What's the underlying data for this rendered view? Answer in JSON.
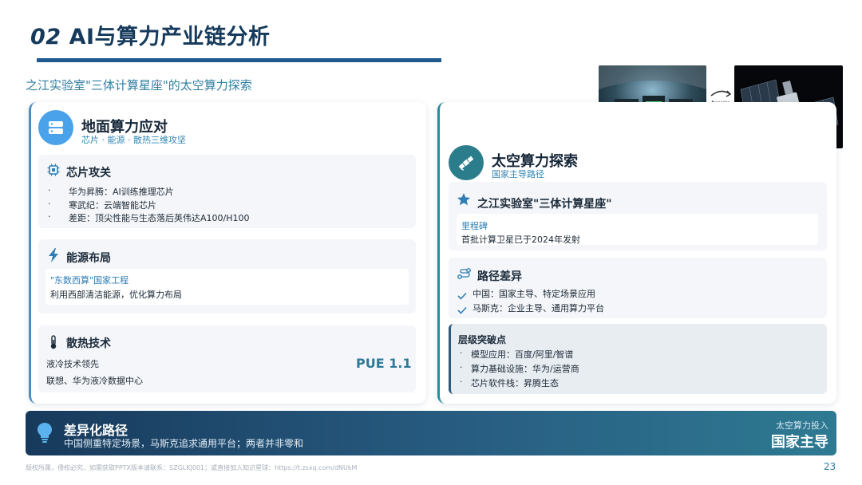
{
  "header": {
    "number": "02",
    "title": "AI与算力产业链分析",
    "subtitle": "之江实验室\"三体计算星座\"的太空算力探索"
  },
  "left_panel": {
    "title": "地面算力应对",
    "subtitle": "芯片 · 能源 · 散热三维攻坚",
    "chip": {
      "title": "芯片攻关",
      "items": [
        "华为昇腾：AI训练推理芯片",
        "寒武纪：云端智能芯片",
        "差距：顶尖性能与生态落后英伟达A100/H100"
      ]
    },
    "energy": {
      "title": "能源布局",
      "project": "\"东数西算\"国家工程",
      "desc": "利用西部清洁能源，优化算力布局"
    },
    "cooling": {
      "title": "散热技术",
      "line1": "液冷技术领先",
      "line2": "联想、华为液冷数据中心",
      "pue": "PUE 1.1"
    }
  },
  "right_panel": {
    "title": "太空算力探索",
    "subtitle": "国家主导路径",
    "constellation": {
      "title": "之江实验室\"三体计算星座\"",
      "milestone_label": "里程碑",
      "milestone_text": "首批计算卫星已于2024年发射"
    },
    "path": {
      "title": "路径差异",
      "items": [
        "中国：国家主导、特定场景应用",
        "马斯克：企业主导、通用算力平台"
      ]
    },
    "breakthrough": {
      "title": "层级突破点",
      "items": [
        "模型应用：百度/阿里/智谱",
        "算力基础设施：华为/运营商",
        "芯片软件栈：昇腾生态"
      ]
    }
  },
  "image": {
    "arrow_caption": "Bypassing Sanctions via Physics"
  },
  "banner": {
    "title": "差异化路径",
    "text": "中国侧重特定场景，马斯克追求通用平台；两者并非零和",
    "label": "太空算力投入",
    "main": "国家主导"
  },
  "footer": {
    "text": "版权所属，侵权必究，如需获取PPTX版本请联系：SZGLKJ001；或直接加入知识星球：https://t.zsxq.com/dNUkM",
    "page": "23"
  },
  "colors": {
    "title": "#163a5c",
    "accent_blue": "#4aa3ea",
    "accent_teal": "#2c7d8c",
    "banner_start": "#173a5c",
    "banner_end": "#2e7a92"
  }
}
